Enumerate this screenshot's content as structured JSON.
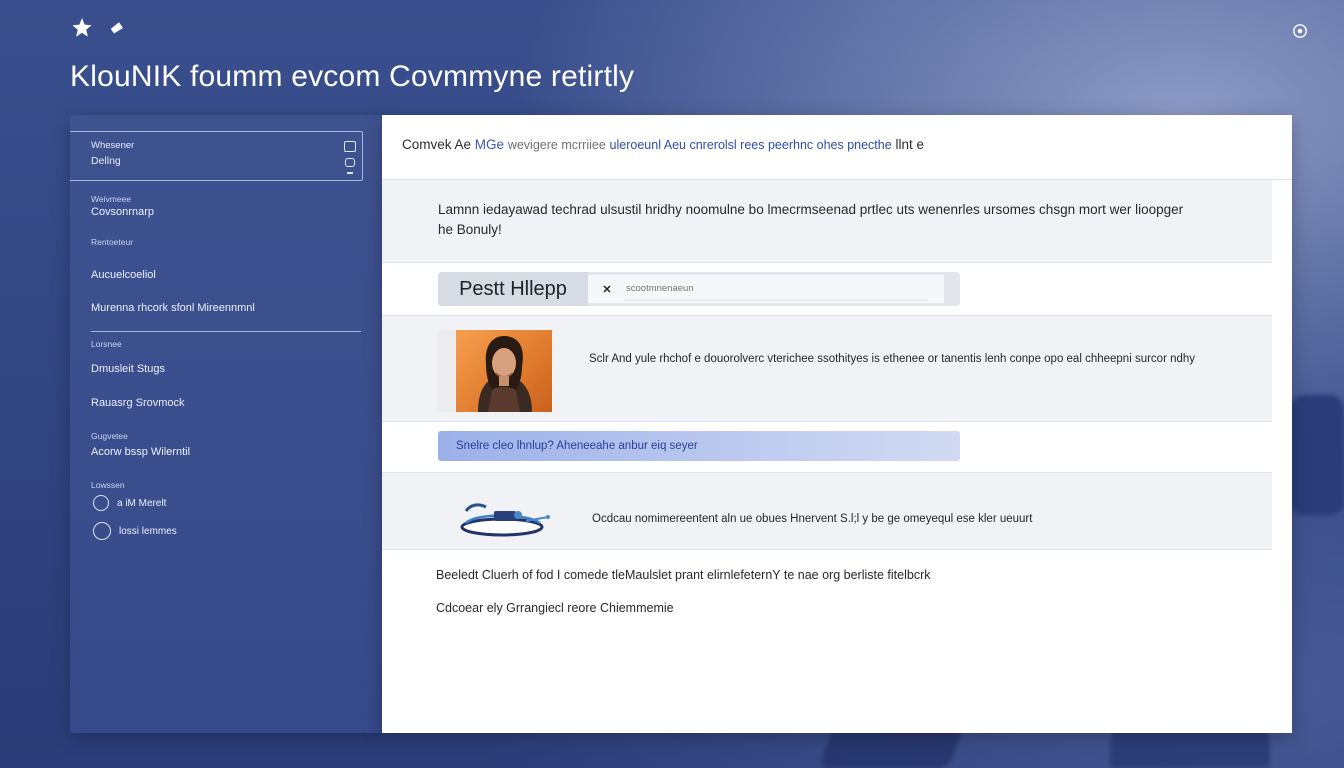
{
  "app": {
    "title": "KlouNIK foumm evcom Covmmyne retirtly"
  },
  "top_icons": [
    "star-icon",
    "tag-icon"
  ],
  "settings_icon": "settings-circle-icon",
  "colors": {
    "background": "#334785",
    "sidebar": "#3c508e",
    "accent": "#3b56b8",
    "avatar_bg": "#e9853a",
    "banner": "#a9bbec"
  },
  "sidebar": {
    "search": {
      "line1": "Whesener",
      "line2": "Dellng"
    },
    "sections": [
      {
        "heading": "Weivmeee",
        "item": "Covsonrnarp"
      },
      {
        "heading": "Rentoeteur",
        "items": [
          "Aucuelcoeliol",
          "Murenna rhcork sfonl Mireennmnl"
        ]
      },
      {
        "heading": "Lorsnee",
        "items": [
          "Dmusleit Stugs",
          "Rauasrg Srovmock"
        ]
      },
      {
        "heading": "Gugvetee",
        "item": "Acorw bssp Wilerntil"
      }
    ],
    "footer": {
      "heading": "Lowssen",
      "items": [
        "a iM Merelt",
        "lossi lemmes"
      ]
    }
  },
  "main": {
    "header": {
      "prefix": "Comvek Ae",
      "link": "MGe",
      "middle": "wevigere mcrriiee",
      "bold": "uleroeunl Aeu cnrerolsl rees peerhnc ohes pnecthe",
      "suffix": "llnt e"
    },
    "intro": "Lamnn iedayawad techrad ulsustil hridhy noomulne bo lmecrmseenad prtlec uts wenenrles ursomes chsgn mort wer lioopger he Bonuly!",
    "help": {
      "button": "Pestt Hllepp",
      "placeholder": "scootmnenaeun"
    },
    "post": {
      "text": "Sclr And yule rhchof e douorolverc vterichee ssothityes is ethenee or tanentis lenh conpe opo eal chheepni surcor ndhy"
    },
    "banner": "Snelre cleo lhnlup? Aheneeahe anbur eiq seyer",
    "feature": {
      "icon": "boat-icon",
      "text": "Ocdcau nomimereentent aln ue obues Hnervent S.l;l y be ge omeyequl ese kler ueuurt"
    },
    "footer_lines": [
      "Beeledt Cluerh of fod I comede tleMaulslet prant elirnlefeternY te nae org berliste fitelbcrk",
      "Cdcoear ely Grrangiecl reore Chiemmemie"
    ]
  }
}
